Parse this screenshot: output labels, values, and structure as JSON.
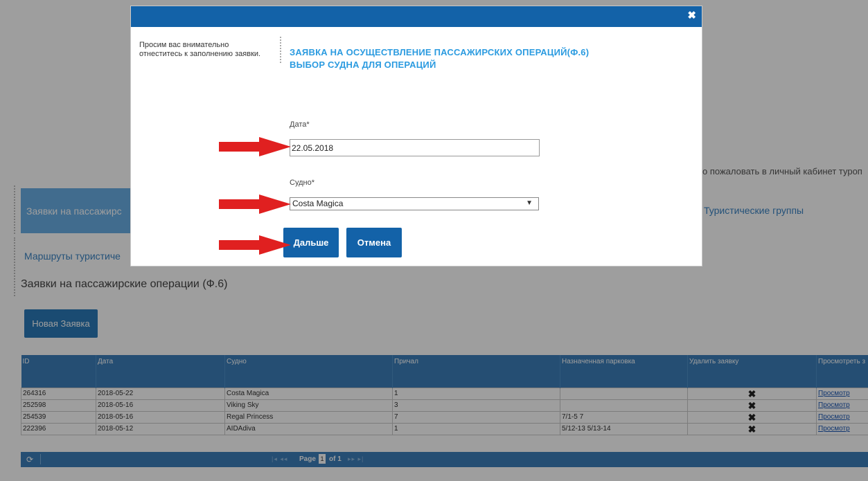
{
  "page": {
    "welcome_text": "о пожаловать в личный кабинет туроп",
    "tab_active_label": "Заявки на пассажирс",
    "tab_groups_label": "Туристические группы",
    "tab_routes_label": "Маршруты туристиче",
    "section_title": "Заявки на пассажирские операции (Ф.6)",
    "new_request_label": "Новая Заявка"
  },
  "table": {
    "headers": [
      "ID",
      "Дата",
      "Судно",
      "Причал",
      "Назначенная парковка",
      "Удалить заявку",
      "Просмотреть з"
    ],
    "rows": [
      {
        "id": "264316",
        "date": "2018-05-22",
        "ship": "Costa Magica",
        "berth": "1",
        "parking": "",
        "delete": "✖",
        "view": "Просмотр"
      },
      {
        "id": "252598",
        "date": "2018-05-16",
        "ship": "Viking Sky",
        "berth": "3",
        "parking": "",
        "delete": "✖",
        "view": "Просмотр"
      },
      {
        "id": "254539",
        "date": "2018-05-16",
        "ship": "Regal Princess",
        "berth": "7",
        "parking": "7/1-5 7",
        "delete": "✖",
        "view": "Просмотр"
      },
      {
        "id": "222396",
        "date": "2018-05-12",
        "ship": "AIDAdiva",
        "berth": "1",
        "parking": "5/12-13 5/13-14",
        "delete": "✖",
        "view": "Просмотр"
      }
    ]
  },
  "pager": {
    "refresh_icon": "⟳",
    "first_prev": "|◂ ◂◂",
    "page_label": "Page",
    "page_value": "1",
    "of_label": "of 1",
    "next_last": "▸▸ ▸|"
  },
  "modal": {
    "close_icon": "✖",
    "note": "Просим вас внимательно отнеститесь к заполнению заявки.",
    "title_line1": "ЗАЯВКА НА ОСУЩЕСТВЛЕНИЕ ПАССАЖИРСКИХ ОПЕРАЦИЙ(Ф.6)",
    "title_line2": "ВЫБОР СУДНА ДЛЯ ОПЕРАЦИЙ",
    "date_label": "Дата*",
    "date_value": "22.05.2018",
    "ship_label": "Судно*",
    "ship_value": "Costa Magica",
    "next_button": "Дальше",
    "cancel_button": "Отмена"
  },
  "colors": {
    "header_blue": "#1362a8",
    "table_blue": "#3c7fba",
    "title_blue": "#2b9be0",
    "arrow_red": "#e02020"
  }
}
